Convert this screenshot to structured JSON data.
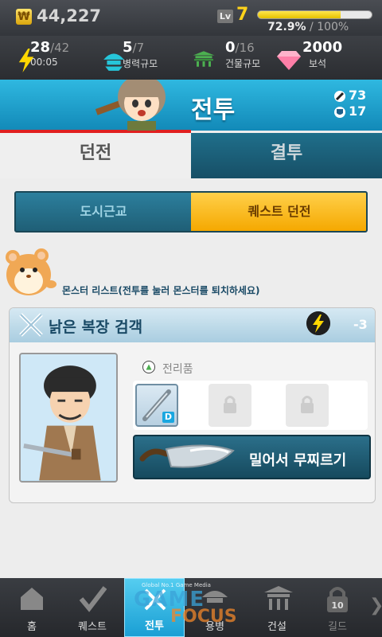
{
  "top": {
    "gold": "44,227",
    "gold_icon": "₩",
    "level_label": "Lv",
    "level": "7",
    "xp_percent_text": "72.9%",
    "xp_total": " / 100%",
    "xp_fraction": 0.729
  },
  "stats": [
    {
      "value": "28",
      "max": "/42",
      "label": "00:05",
      "icon": "lightning-icon"
    },
    {
      "value": "5",
      "max": "/7",
      "label": "병력규모",
      "icon": "troops-icon"
    },
    {
      "value": "0",
      "max": "/16",
      "label": "건물규모",
      "icon": "building-icon"
    },
    {
      "value": "2000",
      "max": "",
      "label": "보석",
      "icon": "gem-icon"
    }
  ],
  "header": {
    "title": "전투",
    "attack": "73",
    "defense": "17"
  },
  "tabs": {
    "dungeon": "던전",
    "duel": "결투"
  },
  "segment": {
    "left": "도시근교",
    "right": "퀘스트 던전"
  },
  "tip": "몬스터 리스트(전투를 눌러 몬스터를 퇴치하세요)",
  "card": {
    "title": "낡은 복장 검객",
    "cost": "-3",
    "loot_label": "전리품",
    "grade": "D",
    "attack_label": "밀어서 무찌르기"
  },
  "nav": [
    {
      "label": "홈"
    },
    {
      "label": "퀘스트"
    },
    {
      "label": "전투"
    },
    {
      "label": "용병"
    },
    {
      "label": "건설"
    },
    {
      "label": "길드",
      "badge": "10"
    }
  ],
  "watermark": {
    "line1": "GAME",
    "line2": "FOCUS",
    "small": "Global No.1 Game Media"
  },
  "colors": {
    "accent": "#1a9fd4",
    "gold": "#ffd31a",
    "quest": "#f5a800"
  }
}
